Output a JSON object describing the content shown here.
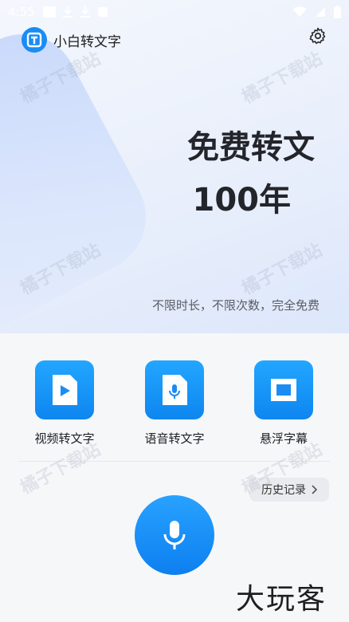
{
  "status_bar": {
    "time": "4:55"
  },
  "app": {
    "title": "小白转文字"
  },
  "hero": {
    "title_line1": "免费转文",
    "title_line2": "100年",
    "subtitle": "不限时长，不限次数，完全免费"
  },
  "features": [
    {
      "label": "视频转文字"
    },
    {
      "label": "语音转文字"
    },
    {
      "label": "悬浮字幕"
    }
  ],
  "history": {
    "label": "历史记录"
  },
  "watermark": {
    "text": "橘子下载站"
  },
  "brand_mark": {
    "text": "大玩客"
  },
  "colors": {
    "accent": "#1a8cf4",
    "text": "#23252b"
  }
}
